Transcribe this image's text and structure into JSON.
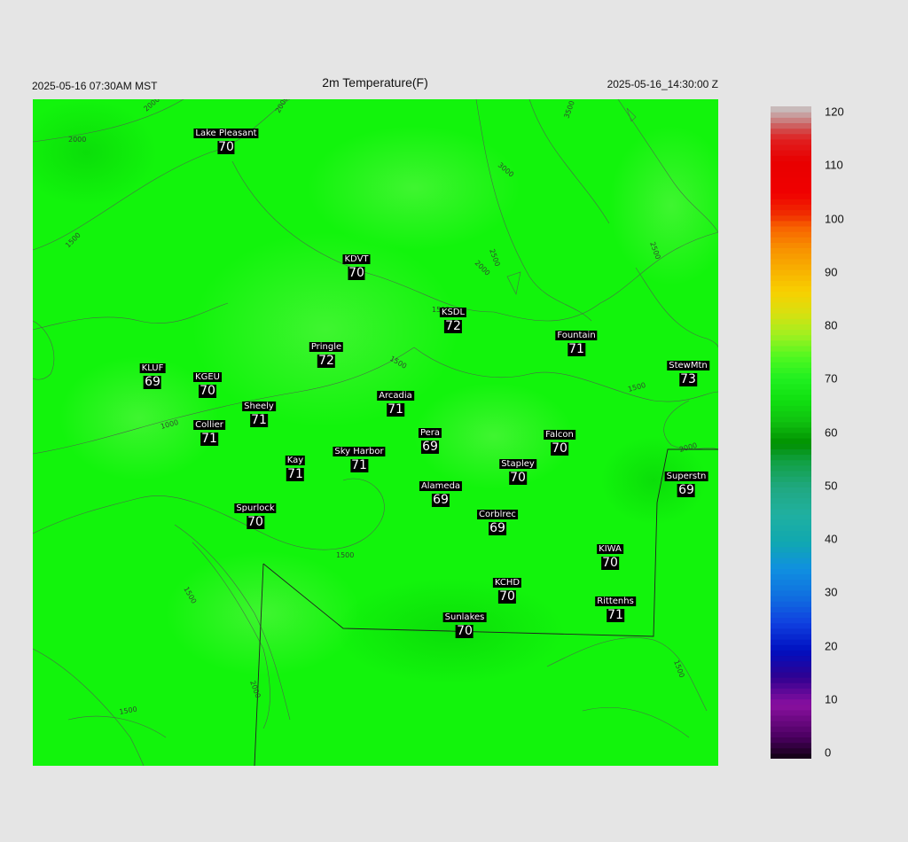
{
  "header": {
    "left": "2025-05-16 07:30AM MST",
    "title": "2m Temperature(F)",
    "right": "2025-05-16_14:30:00 Z"
  },
  "colors": {
    "field_base": "#12f40c",
    "field_light": "#3ef52e",
    "field_dark": "#0bde0b",
    "contour": "#4a6a4a",
    "boundary": "#202020"
  },
  "colorbar": {
    "ticks": [
      "120",
      "110",
      "100",
      "90",
      "80",
      "70",
      "60",
      "50",
      "40",
      "30",
      "20",
      "10",
      "0"
    ],
    "min": 0,
    "max": 120
  },
  "stations": [
    {
      "name": "Lake Pleasant",
      "value": "70"
    },
    {
      "name": "KDVT",
      "value": "70"
    },
    {
      "name": "KSDL",
      "value": "72"
    },
    {
      "name": "Fountain",
      "value": "71"
    },
    {
      "name": "Pringle",
      "value": "72"
    },
    {
      "name": "KLUF",
      "value": "69"
    },
    {
      "name": "KGEU",
      "value": "70"
    },
    {
      "name": "StewMtn",
      "value": "73"
    },
    {
      "name": "Arcadia",
      "value": "71"
    },
    {
      "name": "Sheely",
      "value": "71"
    },
    {
      "name": "Collier",
      "value": "71"
    },
    {
      "name": "Pera",
      "value": "69"
    },
    {
      "name": "Falcon",
      "value": "70"
    },
    {
      "name": "Sky Harbor",
      "value": "71"
    },
    {
      "name": "Kay",
      "value": "71"
    },
    {
      "name": "Stapley",
      "value": "70"
    },
    {
      "name": "Superstn",
      "value": "69"
    },
    {
      "name": "Alameda",
      "value": "69"
    },
    {
      "name": "Spurlock",
      "value": "70"
    },
    {
      "name": "Corblrec",
      "value": "69"
    },
    {
      "name": "KIWA",
      "value": "70"
    },
    {
      "name": "KCHD",
      "value": "70"
    },
    {
      "name": "Rittenhs",
      "value": "71"
    },
    {
      "name": "Sunlakes",
      "value": "70"
    }
  ],
  "contour_labels": [
    "2000",
    "2000",
    "2000",
    "3000",
    "3500",
    "2000",
    "2500",
    "2500",
    "1500",
    "1500",
    "1000",
    "1500",
    "1500",
    "2000",
    "1500",
    "1500",
    "2000",
    "1500",
    "1500"
  ]
}
